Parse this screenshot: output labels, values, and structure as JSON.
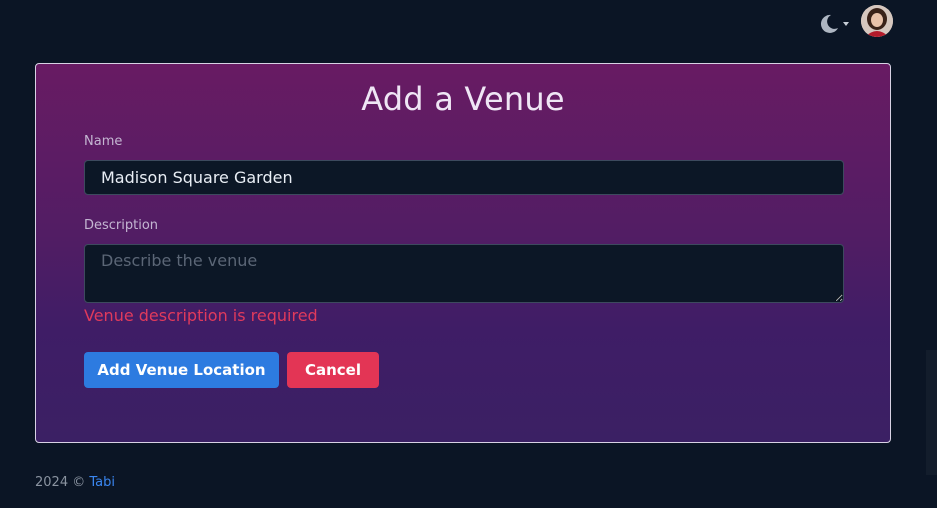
{
  "header": {
    "theme_icon": "moon-icon",
    "avatar_icon": "user-avatar"
  },
  "form": {
    "title": "Add a Venue",
    "name_label": "Name",
    "name_value": "Madison Square Garden",
    "description_label": "Description",
    "description_placeholder": "Describe the venue",
    "description_error": "Venue description is required",
    "add_location_button": "Add Venue Location",
    "cancel_button": "Cancel"
  },
  "footer": {
    "copyright": "2024 © ",
    "link_text": "Tabi"
  },
  "colors": {
    "background": "#0b1525",
    "card_gradient_top": "#681b63",
    "card_gradient_bottom": "#3b2064",
    "primary": "#2d7be0",
    "danger": "#e33555",
    "error_text": "#e03a5c",
    "link": "#3a86f0"
  }
}
